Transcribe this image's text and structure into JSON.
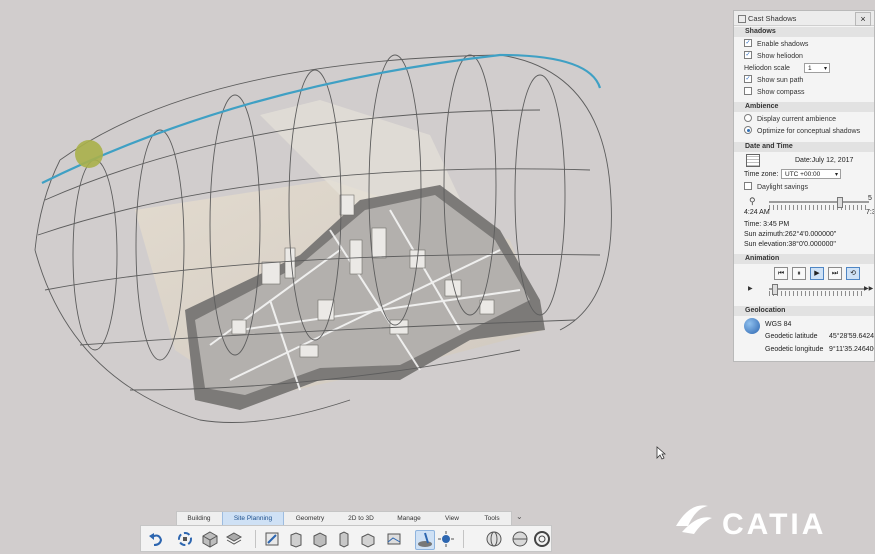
{
  "colors": {
    "background": "#d1cdcd",
    "panel_bg": "#f4f4f4",
    "section_bg": "#e2e2e2",
    "accent_blue": "#2f6fb6",
    "sun": "#a8b04a",
    "sun_path": "#3fa0c4",
    "active_tab": "#cfe1f5"
  },
  "panel": {
    "title": "Cast Shadows",
    "close_label": "×",
    "shadows": {
      "header": "Shadows",
      "enable_shadows": {
        "label": "Enable shadows",
        "checked": true
      },
      "show_heliodon": {
        "label": "Show heliodon",
        "checked": true
      },
      "heliodon_scale_label": "Heliodon scale",
      "heliodon_scale_value": "1",
      "show_sun_path": {
        "label": "Show sun path",
        "checked": true
      },
      "show_compass": {
        "label": "Show compass",
        "checked": false
      }
    },
    "ambience": {
      "header": "Ambience",
      "display_current": {
        "label": "Display current ambience",
        "selected": false
      },
      "optimize": {
        "label": "Optimize for conceptual shadows",
        "selected": true
      }
    },
    "date_time": {
      "header": "Date and Time",
      "date_text": "Date:July 12, 2017",
      "time_zone_label": "Time zone:",
      "time_zone_value": "UTC +00:00",
      "daylight_savings": {
        "label": "Daylight savings",
        "checked": false
      },
      "start_time": "4:24 AM",
      "end_time_partial": "7:3",
      "slider_right_partial": "5",
      "time_text": "Time:  3:45 PM",
      "sun_azimuth": "Sun azimuth:262°4'0.000000\"",
      "sun_elevation": "Sun elevation:38°0'0.000000\""
    },
    "animation": {
      "header": "Animation",
      "buttons": [
        {
          "name": "skip-back-icon",
          "glyph": "⏮"
        },
        {
          "name": "pause-icon",
          "glyph": "⏸"
        },
        {
          "name": "play-icon",
          "glyph": "▶"
        },
        {
          "name": "skip-forward-icon",
          "glyph": "⏭"
        },
        {
          "name": "loop-icon",
          "glyph": "⟲"
        }
      ],
      "slider_end_glyph": "▶▶"
    },
    "geolocation": {
      "header": "Geolocation",
      "datum": "WGS 84",
      "latitude_label": "Geodetic latitude",
      "latitude_value": "45°28'59.6424",
      "longitude_label": "Geodetic longitude",
      "longitude_value": "9°11'35.246400"
    }
  },
  "tabs": [
    {
      "label": "Building",
      "active": false
    },
    {
      "label": "Site Planning",
      "active": true
    },
    {
      "label": "Geometry",
      "active": false
    },
    {
      "label": "2D to 3D",
      "active": false
    },
    {
      "label": "Manage",
      "active": false
    },
    {
      "label": "View",
      "active": false
    },
    {
      "label": "Tools",
      "active": false
    }
  ],
  "toolbar": {
    "icons": [
      "undo-icon",
      "rotate-icon",
      "cube-icon",
      "layers-icon",
      "sketch-icon",
      "building-block-icon",
      "building-block-2-icon",
      "building-block-3-icon",
      "building-block-4-icon",
      "terrain-icon",
      "shadow-sun-icon",
      "light-icon",
      "globe-icon",
      "sphere-icon",
      "torus-icon"
    ]
  },
  "brand": {
    "name": "CATIA",
    "logo": "3DS"
  }
}
